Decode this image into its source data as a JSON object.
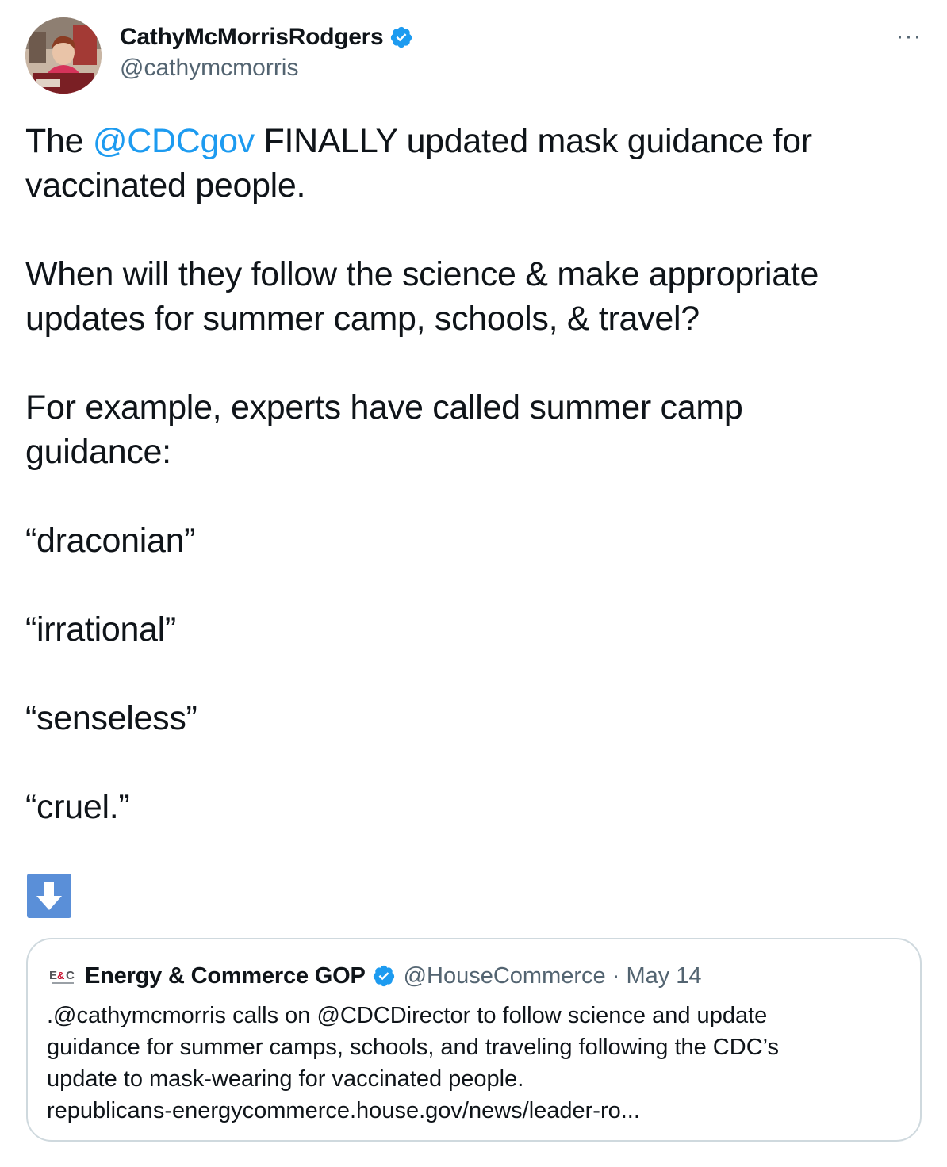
{
  "author": {
    "name": "CathyMcMorrisRodgers",
    "handle": "@cathymcmorris",
    "verified": true
  },
  "more_label": "···",
  "tweet": {
    "line1_prefix": "The ",
    "line1_mention": "@CDCgov",
    "line1_suffix": " FINALLY updated mask guidance for",
    "line2": "vaccinated people.",
    "para2_line1": "When will they follow the science & make appropriate",
    "para2_line2": "updates for summer camp, schools, & travel?",
    "para3_line1": "For example, experts have called summer camp",
    "para3_line2": "guidance:",
    "quote1": "“draconian”",
    "quote2": "“irrational”",
    "quote3": "“senseless”",
    "quote4": "“cruel.”",
    "emoji": "down-arrow-emoji"
  },
  "quoted_tweet": {
    "avatar_text": "E&C",
    "name": "Energy & Commerce GOP",
    "handle": "@HouseCommerce",
    "separator": " · ",
    "date": "May 14",
    "text_line1": ".@cathymcmorris calls on @CDCDirector to follow science and update",
    "text_line2": "guidance for summer camps, schools, and traveling following the CDC’s",
    "text_line3": "update to mask-wearing for vaccinated people.",
    "link": "republicans-energycommerce.house.gov/news/leader-ro..."
  },
  "colors": {
    "link": "#1d9bf0",
    "secondary_text": "#536471",
    "verified": "#1d9bf0",
    "border": "#cfd9de"
  }
}
